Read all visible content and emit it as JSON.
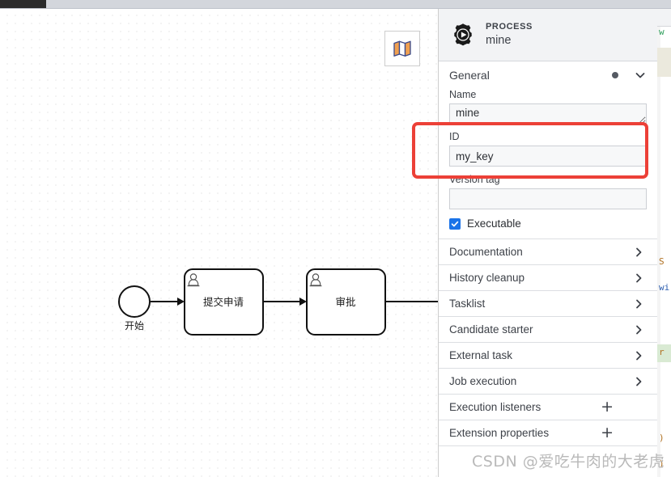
{
  "window": {
    "topbar_tab_label": ""
  },
  "canvas": {
    "minimap_button_title": "Toggle minimap",
    "minimap_icon": "map-icon",
    "diagram": {
      "start_event": {
        "label": "开始",
        "type": "start-event"
      },
      "tasks": [
        {
          "name": "提交申请",
          "type": "user-task"
        },
        {
          "name": "审批",
          "type": "user-task"
        }
      ]
    }
  },
  "panel": {
    "header": {
      "icon": "process-gear-icon",
      "type_label": "PROCESS",
      "title": "mine"
    },
    "general_group": {
      "label": "General",
      "dot_indicator": "modified-dot",
      "chevron": "chevron-down-icon",
      "fields": [
        {
          "label": "Name",
          "value": "mine",
          "placeholder": "",
          "control": "textarea",
          "name": "name-field"
        },
        {
          "label": "ID",
          "value": "my_key",
          "placeholder": "",
          "control": "input",
          "name": "id-field"
        },
        {
          "label": "Version tag",
          "value": "",
          "placeholder": "",
          "control": "input",
          "name": "version-tag-field"
        }
      ],
      "checkbox": {
        "label": "Executable",
        "checked": true,
        "color": "#1a73e8"
      }
    },
    "accordion_items": [
      {
        "label": "Documentation",
        "action": "chevron",
        "name": "accordion-documentation"
      },
      {
        "label": "History cleanup",
        "action": "chevron",
        "name": "accordion-history-cleanup"
      },
      {
        "label": "Tasklist",
        "action": "chevron",
        "name": "accordion-tasklist"
      },
      {
        "label": "Candidate starter",
        "action": "chevron",
        "name": "accordion-candidate-starter"
      },
      {
        "label": "External task",
        "action": "chevron",
        "name": "accordion-external-task"
      },
      {
        "label": "Job execution",
        "action": "chevron",
        "name": "accordion-job-execution"
      },
      {
        "label": "Execution listeners",
        "action": "plus",
        "name": "accordion-execution-listeners"
      },
      {
        "label": "Extension properties",
        "action": "plus",
        "name": "accordion-extension-properties"
      }
    ]
  },
  "watermark": {
    "text": "CSDN @爱吃牛肉的大老虎"
  },
  "colors": {
    "accent_blue": "#1a73e8",
    "annotation_red": "#ec4037",
    "panel_header_bg": "#f2f3f5",
    "topbar_bg": "#d3d6dc"
  }
}
